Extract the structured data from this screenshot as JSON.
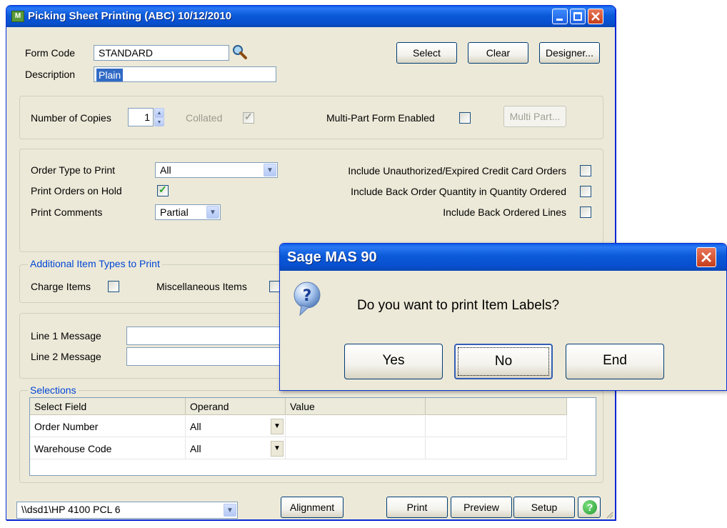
{
  "window": {
    "title": "Picking Sheet Printing (ABC) 10/12/2010",
    "icon": "app-icon",
    "icon_text": "M",
    "controls": {
      "minimize": "minimize-icon",
      "maximize": "maximize-icon",
      "close": "close-icon"
    }
  },
  "header": {
    "form_code_label": "Form Code",
    "form_code_value": "STANDARD",
    "description_label": "Description",
    "description_value": "Plain",
    "select_label": "Select",
    "clear_label": "Clear",
    "designer_label": "Designer..."
  },
  "copies": {
    "label": "Number of Copies",
    "value": "1",
    "collated_label": "Collated",
    "multipart_label": "Multi-Part Form Enabled",
    "multipart_button": "Multi Part..."
  },
  "options": {
    "order_type_label": "Order Type to Print",
    "order_type_value": "All",
    "hold_label": "Print Orders on Hold",
    "comments_label": "Print Comments",
    "comments_value": "Partial",
    "unauthorized_label": "Include Unauthorized/Expired Credit Card Orders",
    "backorder_qty_label": "Include Back Order Quantity in Quantity Ordered",
    "backorder_lines_label": "Include Back Ordered Lines"
  },
  "additional": {
    "legend": "Additional Item Types to Print",
    "charge_label": "Charge Items",
    "misc_label": "Miscellaneous Items"
  },
  "messages": {
    "line1_label": "Line 1 Message",
    "line2_label": "Line 2 Message"
  },
  "selections": {
    "legend": "Selections",
    "columns": [
      "Select Field",
      "Operand",
      "Value",
      ""
    ],
    "rows": [
      {
        "field": "Order Number",
        "operand": "All"
      },
      {
        "field": "Warehouse Code",
        "operand": "All"
      }
    ]
  },
  "footer": {
    "printer": "\\\\dsd1\\HP 4100 PCL 6",
    "alignment_label": "Alignment",
    "print_label": "Print",
    "preview_label": "Preview",
    "setup_label": "Setup",
    "help_icon": "help-icon"
  },
  "dialog": {
    "title": "Sage MAS 90",
    "message": "Do you want to print Item Labels?",
    "icon": "question-icon",
    "yes_label": "Yes",
    "no_label": "No",
    "end_label": "End"
  },
  "colors": {
    "titlebar": "#0a5ae6",
    "window_bg": "#ece9d8",
    "legend_text": "#0046d5",
    "close_button": "#d4502c"
  }
}
